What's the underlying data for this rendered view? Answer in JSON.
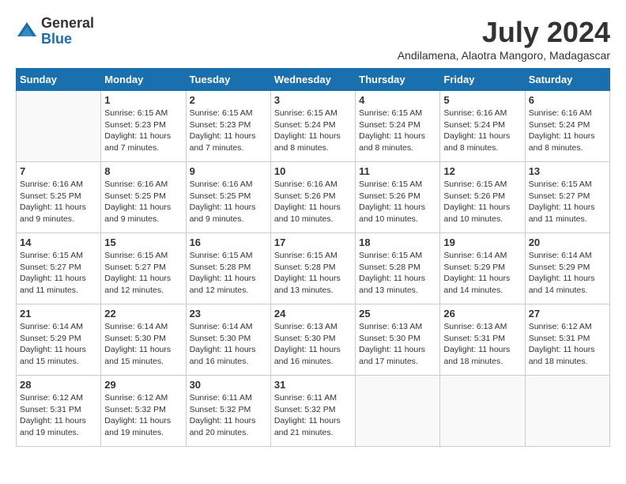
{
  "logo": {
    "general": "General",
    "blue": "Blue"
  },
  "title": {
    "month_year": "July 2024",
    "location": "Andilamena, Alaotra Mangoro, Madagascar"
  },
  "days_of_week": [
    "Sunday",
    "Monday",
    "Tuesday",
    "Wednesday",
    "Thursday",
    "Friday",
    "Saturday"
  ],
  "weeks": [
    [
      {
        "day": "",
        "sunrise": "",
        "sunset": "",
        "daylight": "",
        "empty": true
      },
      {
        "day": "1",
        "sunrise": "Sunrise: 6:15 AM",
        "sunset": "Sunset: 5:23 PM",
        "daylight": "Daylight: 11 hours and 7 minutes."
      },
      {
        "day": "2",
        "sunrise": "Sunrise: 6:15 AM",
        "sunset": "Sunset: 5:23 PM",
        "daylight": "Daylight: 11 hours and 7 minutes."
      },
      {
        "day": "3",
        "sunrise": "Sunrise: 6:15 AM",
        "sunset": "Sunset: 5:24 PM",
        "daylight": "Daylight: 11 hours and 8 minutes."
      },
      {
        "day": "4",
        "sunrise": "Sunrise: 6:15 AM",
        "sunset": "Sunset: 5:24 PM",
        "daylight": "Daylight: 11 hours and 8 minutes."
      },
      {
        "day": "5",
        "sunrise": "Sunrise: 6:16 AM",
        "sunset": "Sunset: 5:24 PM",
        "daylight": "Daylight: 11 hours and 8 minutes."
      },
      {
        "day": "6",
        "sunrise": "Sunrise: 6:16 AM",
        "sunset": "Sunset: 5:24 PM",
        "daylight": "Daylight: 11 hours and 8 minutes."
      }
    ],
    [
      {
        "day": "7",
        "sunrise": "Sunrise: 6:16 AM",
        "sunset": "Sunset: 5:25 PM",
        "daylight": "Daylight: 11 hours and 9 minutes."
      },
      {
        "day": "8",
        "sunrise": "Sunrise: 6:16 AM",
        "sunset": "Sunset: 5:25 PM",
        "daylight": "Daylight: 11 hours and 9 minutes."
      },
      {
        "day": "9",
        "sunrise": "Sunrise: 6:16 AM",
        "sunset": "Sunset: 5:25 PM",
        "daylight": "Daylight: 11 hours and 9 minutes."
      },
      {
        "day": "10",
        "sunrise": "Sunrise: 6:16 AM",
        "sunset": "Sunset: 5:26 PM",
        "daylight": "Daylight: 11 hours and 10 minutes."
      },
      {
        "day": "11",
        "sunrise": "Sunrise: 6:15 AM",
        "sunset": "Sunset: 5:26 PM",
        "daylight": "Daylight: 11 hours and 10 minutes."
      },
      {
        "day": "12",
        "sunrise": "Sunrise: 6:15 AM",
        "sunset": "Sunset: 5:26 PM",
        "daylight": "Daylight: 11 hours and 10 minutes."
      },
      {
        "day": "13",
        "sunrise": "Sunrise: 6:15 AM",
        "sunset": "Sunset: 5:27 PM",
        "daylight": "Daylight: 11 hours and 11 minutes."
      }
    ],
    [
      {
        "day": "14",
        "sunrise": "Sunrise: 6:15 AM",
        "sunset": "Sunset: 5:27 PM",
        "daylight": "Daylight: 11 hours and 11 minutes."
      },
      {
        "day": "15",
        "sunrise": "Sunrise: 6:15 AM",
        "sunset": "Sunset: 5:27 PM",
        "daylight": "Daylight: 11 hours and 12 minutes."
      },
      {
        "day": "16",
        "sunrise": "Sunrise: 6:15 AM",
        "sunset": "Sunset: 5:28 PM",
        "daylight": "Daylight: 11 hours and 12 minutes."
      },
      {
        "day": "17",
        "sunrise": "Sunrise: 6:15 AM",
        "sunset": "Sunset: 5:28 PM",
        "daylight": "Daylight: 11 hours and 13 minutes."
      },
      {
        "day": "18",
        "sunrise": "Sunrise: 6:15 AM",
        "sunset": "Sunset: 5:28 PM",
        "daylight": "Daylight: 11 hours and 13 minutes."
      },
      {
        "day": "19",
        "sunrise": "Sunrise: 6:14 AM",
        "sunset": "Sunset: 5:29 PM",
        "daylight": "Daylight: 11 hours and 14 minutes."
      },
      {
        "day": "20",
        "sunrise": "Sunrise: 6:14 AM",
        "sunset": "Sunset: 5:29 PM",
        "daylight": "Daylight: 11 hours and 14 minutes."
      }
    ],
    [
      {
        "day": "21",
        "sunrise": "Sunrise: 6:14 AM",
        "sunset": "Sunset: 5:29 PM",
        "daylight": "Daylight: 11 hours and 15 minutes."
      },
      {
        "day": "22",
        "sunrise": "Sunrise: 6:14 AM",
        "sunset": "Sunset: 5:30 PM",
        "daylight": "Daylight: 11 hours and 15 minutes."
      },
      {
        "day": "23",
        "sunrise": "Sunrise: 6:14 AM",
        "sunset": "Sunset: 5:30 PM",
        "daylight": "Daylight: 11 hours and 16 minutes."
      },
      {
        "day": "24",
        "sunrise": "Sunrise: 6:13 AM",
        "sunset": "Sunset: 5:30 PM",
        "daylight": "Daylight: 11 hours and 16 minutes."
      },
      {
        "day": "25",
        "sunrise": "Sunrise: 6:13 AM",
        "sunset": "Sunset: 5:30 PM",
        "daylight": "Daylight: 11 hours and 17 minutes."
      },
      {
        "day": "26",
        "sunrise": "Sunrise: 6:13 AM",
        "sunset": "Sunset: 5:31 PM",
        "daylight": "Daylight: 11 hours and 18 minutes."
      },
      {
        "day": "27",
        "sunrise": "Sunrise: 6:12 AM",
        "sunset": "Sunset: 5:31 PM",
        "daylight": "Daylight: 11 hours and 18 minutes."
      }
    ],
    [
      {
        "day": "28",
        "sunrise": "Sunrise: 6:12 AM",
        "sunset": "Sunset: 5:31 PM",
        "daylight": "Daylight: 11 hours and 19 minutes."
      },
      {
        "day": "29",
        "sunrise": "Sunrise: 6:12 AM",
        "sunset": "Sunset: 5:32 PM",
        "daylight": "Daylight: 11 hours and 19 minutes."
      },
      {
        "day": "30",
        "sunrise": "Sunrise: 6:11 AM",
        "sunset": "Sunset: 5:32 PM",
        "daylight": "Daylight: 11 hours and 20 minutes."
      },
      {
        "day": "31",
        "sunrise": "Sunrise: 6:11 AM",
        "sunset": "Sunset: 5:32 PM",
        "daylight": "Daylight: 11 hours and 21 minutes."
      },
      {
        "day": "",
        "sunrise": "",
        "sunset": "",
        "daylight": "",
        "empty": true
      },
      {
        "day": "",
        "sunrise": "",
        "sunset": "",
        "daylight": "",
        "empty": true
      },
      {
        "day": "",
        "sunrise": "",
        "sunset": "",
        "daylight": "",
        "empty": true
      }
    ]
  ]
}
